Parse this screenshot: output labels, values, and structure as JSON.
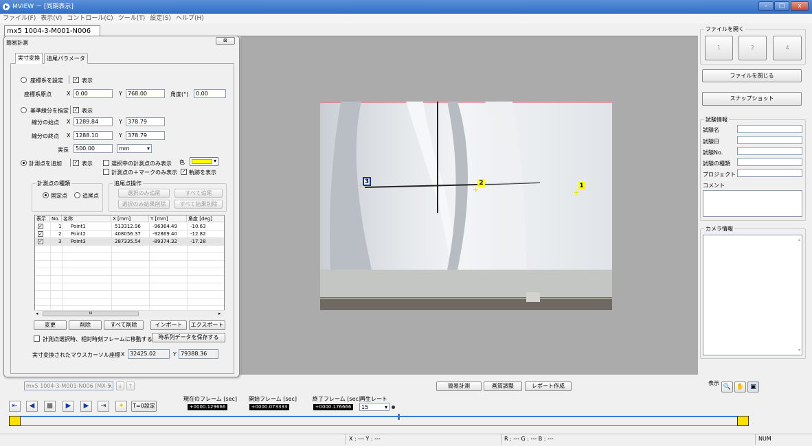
{
  "window": {
    "title": "MVIEW － [同期表示]",
    "min": "–",
    "max": "□",
    "close": "x"
  },
  "menu": [
    "ファイル(F)",
    "表示(V)",
    "コントロール(C)",
    "ツール(T)",
    "設定(S)",
    "ヘルプ(H)"
  ],
  "doc_tab": "mx5 1004-3-M001-N006",
  "dialog": {
    "title": "簡易計測",
    "close": "⊠",
    "tabs": [
      "実寸変換",
      "追尾パラメータ"
    ],
    "coord": {
      "label": "座標系を設定",
      "show": "表示",
      "origin_label": "座標系原点",
      "x_label": "X",
      "x": "0.00",
      "y_label": "Y",
      "y": "768.00",
      "angle_label": "角度(°)",
      "angle": "0.00"
    },
    "ref": {
      "label": "基準線分を指定",
      "show": "表示",
      "start_label": "線分の始点",
      "sx": "1289.84",
      "sy": "378.79",
      "end_label": "線分の終点",
      "ex": "1288.10",
      "ey": "378.79",
      "length_label": "実長",
      "length": "500.00",
      "unit": "mm"
    },
    "add": {
      "label": "計測点を追加",
      "show": "表示",
      "only_selected": "選択中の計測点のみ表示",
      "only_mark": "計測点の＋マークのみ表示",
      "track": "軌跡を表示",
      "color_label": "色",
      "color": "#ffff00"
    },
    "kind": {
      "title": "計測点の種類",
      "fixed": "固定点",
      "track": "追尾点"
    },
    "ops": {
      "title": "追尾点操作",
      "b1": "選択のみ追尾",
      "b2": "すべて追尾",
      "b3": "選択のみ結果削除",
      "b4": "すべて結果削除"
    },
    "table": {
      "headers": [
        "表示",
        "No.",
        "名称",
        "X [mm]",
        "Y [mm]",
        "角度 [deg]"
      ],
      "rows": [
        {
          "no": "1",
          "name": "Point1",
          "x": "513312.96",
          "y": "-96364.49",
          "angle": "-10.63"
        },
        {
          "no": "2",
          "name": "Point2",
          "x": "408056.37",
          "y": "-92869.40",
          "angle": "-12.82"
        },
        {
          "no": "3",
          "name": "Point3",
          "x": "287335.54",
          "y": "-89374.32",
          "angle": "-17.28"
        }
      ],
      "scroll_mid": "III"
    },
    "buttons": {
      "change": "変更",
      "delete": "削除",
      "delete_all": "すべて削除",
      "import": "インポート",
      "export": "エクスポート",
      "save_series": "時系列データを保存する"
    },
    "move_frame": "計測点選択時、相対時刻フレームに移動する",
    "mouse": {
      "label": "実寸変換されたマウスカーソル座標",
      "x_label": "X",
      "x": "32425.02",
      "y_label": "Y",
      "y": "79388.36"
    }
  },
  "image_markers": [
    "3",
    "2",
    "1"
  ],
  "right": {
    "open_group": "ファイルを開く",
    "open_slots": [
      "1",
      "2",
      "4"
    ],
    "close_file": "ファイルを閉じる",
    "snapshot": "スナップショット",
    "test_group": "試験情報",
    "test_fields": [
      "試験名",
      "試験日",
      "試験No.",
      "試験の種類",
      "プロジェクト"
    ],
    "comment": "コメント",
    "camera_group": "カメラ情報",
    "display_label": "表示"
  },
  "bottom": {
    "camera_select": "mx5 1004-3-M001-N006 [MX-5...",
    "down": "↓",
    "up": "↑",
    "tab_measure": "簡易計測",
    "tab_image": "画質調整",
    "tab_report": "レポート作成",
    "t0": "T=0設定",
    "current_label": "現在のフレーム [sec]",
    "current": "+0000.129666",
    "start_label": "開始フレーム [sec]",
    "start": "+0000.073333",
    "end_label": "終了フレーム [sec]",
    "end": "+0000.176666",
    "rate_label": "再生レート",
    "rate": "15"
  },
  "status": {
    "xy": "X : ---  Y : ---",
    "rgb": "R : ---  G : ---  B : ---",
    "num": "NUM"
  }
}
